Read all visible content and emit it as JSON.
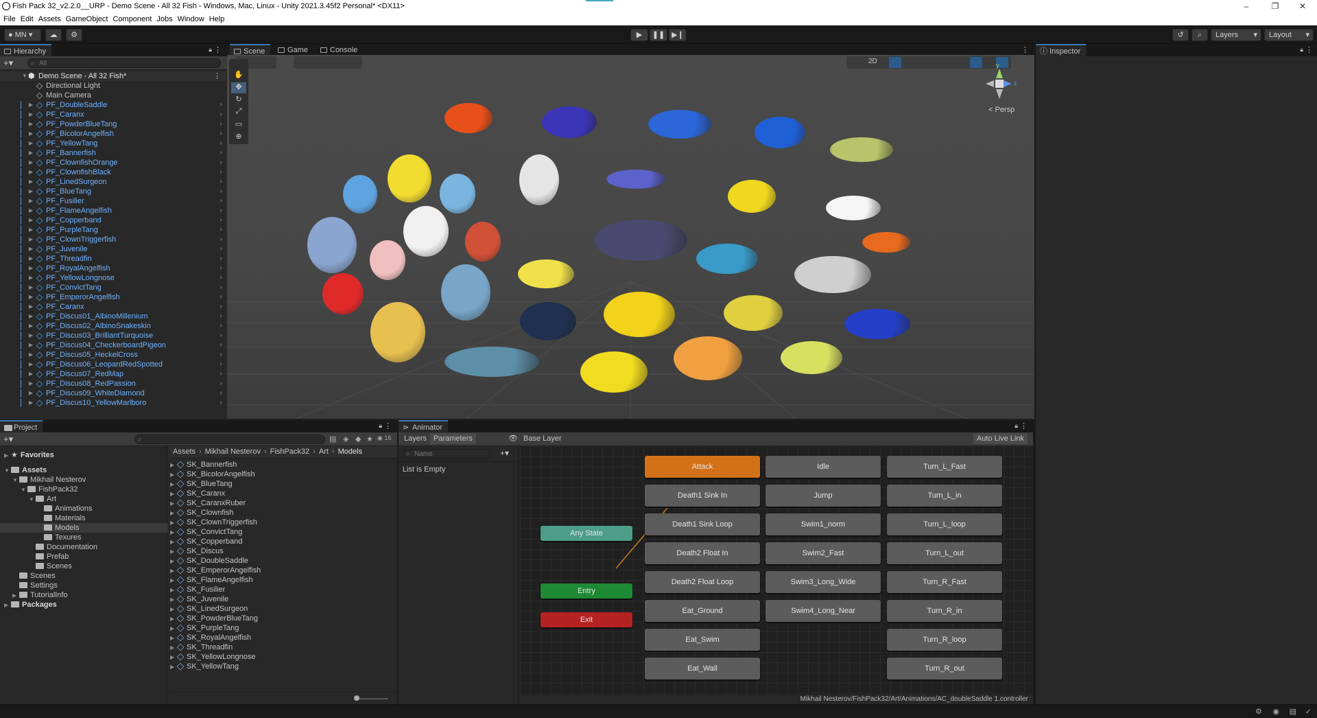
{
  "window": {
    "title": "Fish Pack 32_v2.2.0__URP - Demo Scene - All 32 Fish - Windows, Mac, Linux - Unity 2021.3.45f2 Personal* <DX11>",
    "minimize": "–",
    "maximize": "❐",
    "close": "✕"
  },
  "menu": [
    "File",
    "Edit",
    "Assets",
    "GameObject",
    "Component",
    "Jobs",
    "Window",
    "Help"
  ],
  "toolbar": {
    "account": "MN",
    "layers": "Layers",
    "layout": "Layout"
  },
  "hierarchy": {
    "tab": "Hierarchy",
    "search_placeholder": "All",
    "scene_name": "Demo Scene - All 32 Fish*",
    "items": [
      {
        "label": "Directional Light",
        "prefab": false
      },
      {
        "label": "Main Camera",
        "prefab": false
      },
      {
        "label": "PF_DoubleSaddle",
        "prefab": true
      },
      {
        "label": "PF_Caranx",
        "prefab": true
      },
      {
        "label": "PF_PowderBlueTang",
        "prefab": true
      },
      {
        "label": "PF_BicolorAngelfish",
        "prefab": true
      },
      {
        "label": "PF_YellowTang",
        "prefab": true
      },
      {
        "label": "PF_Bannerfish",
        "prefab": true
      },
      {
        "label": "PF_ClownfishOrange",
        "prefab": true
      },
      {
        "label": "PF_ClownfishBlack",
        "prefab": true
      },
      {
        "label": "PF_LinedSurgeon",
        "prefab": true
      },
      {
        "label": "PF_BlueTang",
        "prefab": true
      },
      {
        "label": "PF_Fusilier",
        "prefab": true
      },
      {
        "label": "PF_FlameAngelfish",
        "prefab": true
      },
      {
        "label": "PF_Copperband",
        "prefab": true
      },
      {
        "label": "PF_PurpleTang",
        "prefab": true
      },
      {
        "label": "PF_ClownTriggerfish",
        "prefab": true
      },
      {
        "label": "PF_Juvenile",
        "prefab": true
      },
      {
        "label": "PF_Threadfin",
        "prefab": true
      },
      {
        "label": "PF_RoyalAngelfish",
        "prefab": true
      },
      {
        "label": "PF_YellowLongnose",
        "prefab": true
      },
      {
        "label": "PF_ConvictTang",
        "prefab": true
      },
      {
        "label": "PF_EmperorAngelfish",
        "prefab": true
      },
      {
        "label": "PF_Caranx",
        "prefab": true
      },
      {
        "label": "PF_Discus01_AlbinoMillenium",
        "prefab": true
      },
      {
        "label": "PF_Discus02_AlbinoSnakeskin",
        "prefab": true
      },
      {
        "label": "PF_Discus03_BrilliantTurquoise",
        "prefab": true
      },
      {
        "label": "PF_Discus04_CheckerboardPigeon",
        "prefab": true
      },
      {
        "label": "PF_Discus05_HeckelCross",
        "prefab": true
      },
      {
        "label": "PF_Discus06_LeopardRedSpotted",
        "prefab": true
      },
      {
        "label": "PF_Discus07_RedMap",
        "prefab": true
      },
      {
        "label": "PF_Discus08_RedPassion",
        "prefab": true
      },
      {
        "label": "PF_Discus09_WhiteDiamond",
        "prefab": true
      },
      {
        "label": "PF_Discus10_YellowMarlboro",
        "prefab": true
      }
    ]
  },
  "scene_tabs": {
    "scene": "Scene",
    "game": "Game",
    "console": "Console"
  },
  "scene_toolbar": {
    "mode_2d": "2D"
  },
  "gizmo": {
    "persp": "< Persp",
    "y": "y",
    "z": "z"
  },
  "inspector": {
    "tab": "Inspector"
  },
  "project": {
    "tab": "Project",
    "hidden_count": "16",
    "tree": [
      {
        "label": "Favorites",
        "depth": 0,
        "type": "star"
      },
      {
        "label": "Assets",
        "depth": 0,
        "type": "folder"
      },
      {
        "label": "Mikhail Nesterov",
        "depth": 1,
        "type": "folder"
      },
      {
        "label": "FishPack32",
        "depth": 2,
        "type": "folder"
      },
      {
        "label": "Art",
        "depth": 3,
        "type": "folder"
      },
      {
        "label": "Animations",
        "depth": 4,
        "type": "folder"
      },
      {
        "label": "Materials",
        "depth": 4,
        "type": "folder"
      },
      {
        "label": "Models",
        "depth": 4,
        "type": "folder",
        "selected": true
      },
      {
        "label": "Texures",
        "depth": 4,
        "type": "folder"
      },
      {
        "label": "Documentation",
        "depth": 3,
        "type": "folder"
      },
      {
        "label": "Prefab",
        "depth": 3,
        "type": "folder"
      },
      {
        "label": "Scenes",
        "depth": 3,
        "type": "folder"
      },
      {
        "label": "Scenes",
        "depth": 1,
        "type": "folder"
      },
      {
        "label": "Settings",
        "depth": 1,
        "type": "folder"
      },
      {
        "label": "TutorialInfo",
        "depth": 1,
        "type": "folder"
      },
      {
        "label": "Packages",
        "depth": 0,
        "type": "folder"
      }
    ],
    "breadcrumb": [
      "Assets",
      "Mikhail Nesterov",
      "FishPack32",
      "Art",
      "Models"
    ],
    "assets": [
      "SK_Bannerfish",
      "SK_BicolorAngelfish",
      "SK_BlueTang",
      "SK_Caranx",
      "SK_CaranxRuber",
      "SK_Clownfish",
      "SK_ClownTriggerfish",
      "SK_ConvictTang",
      "SK_Copperband",
      "SK_Discus",
      "SK_DoubleSaddle",
      "SK_EmperorAngelfish",
      "SK_FlameAngelfish",
      "SK_Fusilier",
      "SK_Juvenile",
      "SK_LinedSurgeon",
      "SK_PowderBlueTang",
      "SK_PurpleTang",
      "SK_RoyalAngelfish",
      "SK_Threadfin",
      "SK_YellowLongnose",
      "SK_YellowTang"
    ]
  },
  "animator": {
    "tab": "Animator",
    "layers_tab": "Layers",
    "parameters_tab": "Parameters",
    "base_layer": "Base Layer",
    "auto_live_link": "Auto Live Link",
    "name_placeholder": "Name",
    "empty_text": "List is Empty",
    "any_state": "Any State",
    "entry": "Entry",
    "exit": "Exit",
    "states_col1": [
      "Attack",
      "Death1 Sink In",
      "Death1 Sink Loop",
      "Death2 Float In",
      "Death2 Float Loop",
      "Eat_Ground",
      "Eat_Swim",
      "Eat_Wall"
    ],
    "states_col2": [
      "Idle",
      "Jump",
      "Swim1_norm",
      "Swim2_Fast",
      "Swim3_Long_Wide",
      "Swim4_Long_Near"
    ],
    "states_col3": [
      "Turn_L_Fast",
      "Turn_L_in",
      "Turn_L_loop",
      "Turn_L_out",
      "Turn_R_Fast",
      "Turn_R_in",
      "Turn_R_loop",
      "Turn_R_out"
    ],
    "controller_path": "Mikhail Nesterov/FishPack32/Art/Animations/AC_doubleSaddle 1.controller"
  }
}
